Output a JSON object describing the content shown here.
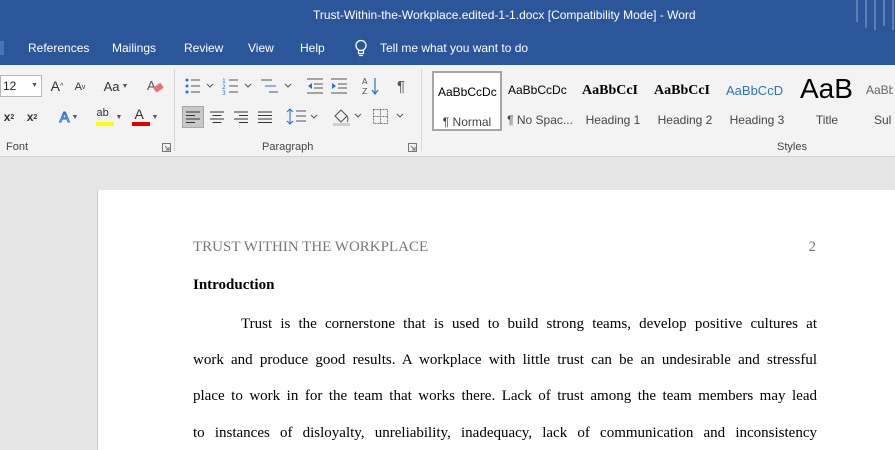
{
  "window": {
    "title": "Trust-Within-the-Workplace.edited-1-1.docx [Compatibility Mode]  -  Word"
  },
  "menu": {
    "items": [
      "References",
      "Mailings",
      "Review",
      "View",
      "Help"
    ],
    "tell_me": "Tell me what you want to do"
  },
  "ribbon": {
    "font": {
      "size_value": "12",
      "label": "Font",
      "grow": "A",
      "shrink": "A",
      "change_case": "Aa",
      "subscript": "x",
      "superscript": "x",
      "text_effects": "A",
      "highlight": "ab",
      "font_color": "A"
    },
    "paragraph": {
      "label": "Paragraph",
      "pilcrow": "¶"
    },
    "styles": {
      "label": "Styles",
      "items": [
        {
          "preview": "AaBbCcDc",
          "name": "¶ Normal",
          "selected": true
        },
        {
          "preview": "AaBbCcDc",
          "name": "¶ No Spac..."
        },
        {
          "preview": "AaBbCcI",
          "name": "Heading 1"
        },
        {
          "preview": "AaBbCcI",
          "name": "Heading 2"
        },
        {
          "preview": "AaBbCcD",
          "name": "Heading 3"
        },
        {
          "preview": "AaB",
          "name": "Title"
        },
        {
          "preview": "AaBb",
          "name": "Sul"
        }
      ]
    }
  },
  "document": {
    "header_left": "TRUST WITHIN THE WORKPLACE",
    "page_number": "2",
    "heading": "Introduction",
    "lines": [
      "Trust is the cornerstone that is used to build strong teams, develop positive cultures at",
      "work and produce good results. A workplace with little trust can be an undesirable and stressful",
      "place to work in for the team that works there. Lack of trust among the team members may lead",
      "to instances of disloyalty, unreliability, inadequacy, lack of communication and inconsistency"
    ]
  },
  "colors": {
    "titlebar": "#2b579a",
    "ribbon": "#f3f3f3",
    "workspace": "#e6e6e6",
    "header_text": "#777777",
    "highlight_yellow": "#ffff00",
    "font_red": "#e00000"
  }
}
